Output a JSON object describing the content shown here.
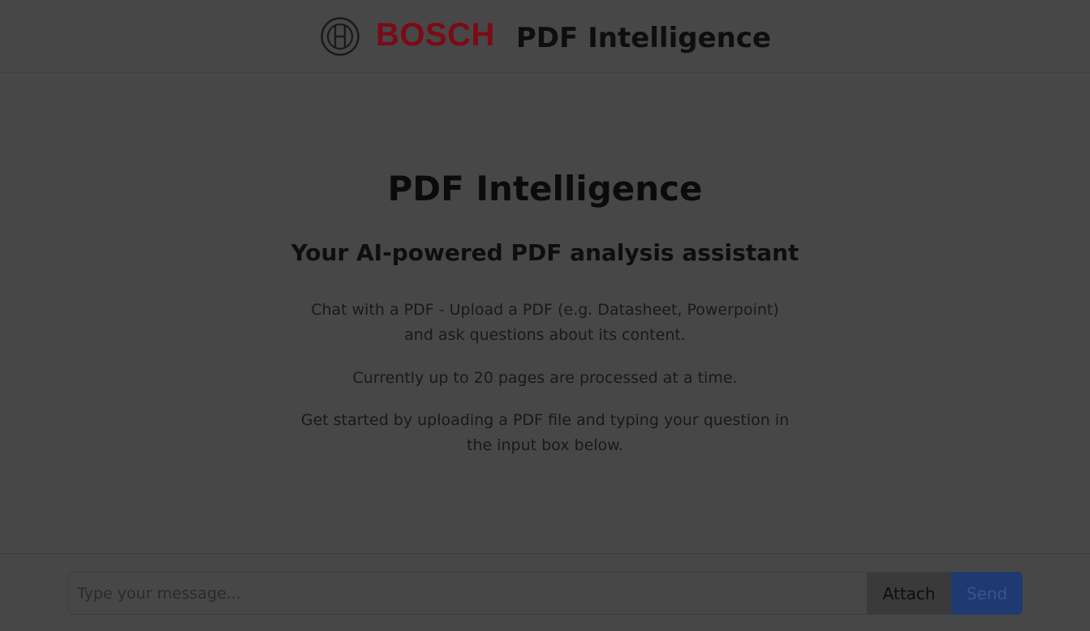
{
  "header": {
    "brand": "BOSCH",
    "title": "PDF Intelligence",
    "logo_icon": "bosch-armature-icon"
  },
  "main": {
    "title": "PDF Intelligence",
    "subtitle": "Your AI-powered PDF analysis assistant",
    "paragraph1": {
      "line1": "Chat with a PDF - Upload a PDF (e.g. Datasheet, Powerpoint)",
      "line2": "and ask questions about its content."
    },
    "paragraph2": "Currently up to 20 pages are processed at a time.",
    "paragraph3": {
      "line1": "Get started by uploading a PDF file and typing your question in",
      "line2": "the input box below."
    }
  },
  "composer": {
    "placeholder": "Type your message...",
    "value": "",
    "attach_label": "Attach",
    "send_label": "Send"
  },
  "colors": {
    "background": "#474747",
    "brand_red": "#7a0b16",
    "send_button": "#1f3a70"
  }
}
